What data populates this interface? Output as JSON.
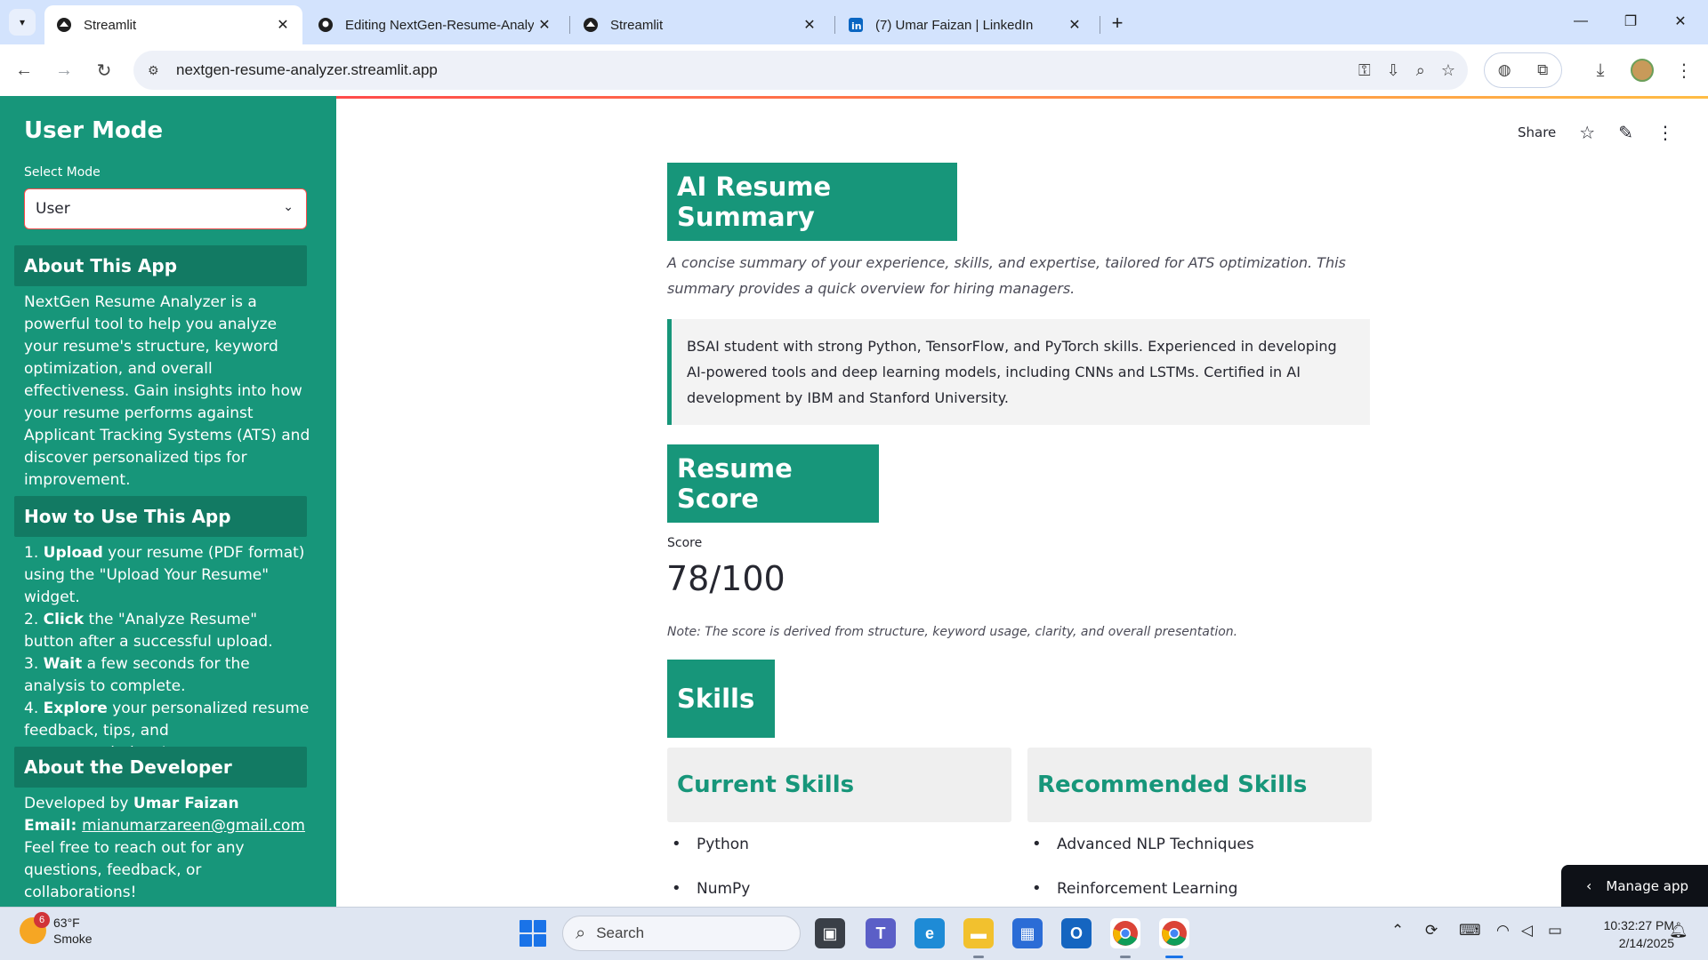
{
  "browser": {
    "tabs": [
      {
        "title": "Streamlit",
        "icon": "streamlit-icon",
        "active": true
      },
      {
        "title": "Editing NextGen-Resume-Analy",
        "icon": "github-icon",
        "active": false
      },
      {
        "title": "Streamlit",
        "icon": "streamlit-icon",
        "active": false
      },
      {
        "title": "(7) Umar Faizan | LinkedIn",
        "icon": "linkedin-icon",
        "active": false
      }
    ],
    "url": "nextgen-resume-analyzer.streamlit.app"
  },
  "sidebar": {
    "title": "User Mode",
    "select_label": "Select Mode",
    "select_value": "User",
    "about": {
      "heading": "About This App",
      "text": "NextGen Resume Analyzer is a powerful tool to help you analyze your resume's structure, keyword optimization, and overall effectiveness. Gain insights into how your resume performs against Applicant Tracking Systems (ATS) and discover personalized tips for improvement."
    },
    "howto": {
      "heading": "How to Use This App",
      "steps": [
        {
          "num": "1.",
          "bold": "Upload",
          "rest": " your resume (PDF format) using the \"Upload Your Resume\" widget."
        },
        {
          "num": "2.",
          "bold": "Click",
          "rest": " the \"Analyze Resume\" button after a successful upload."
        },
        {
          "num": "3.",
          "bold": "Wait",
          "rest": " a few seconds for the analysis to complete."
        },
        {
          "num": "4.",
          "bold": "Explore",
          "rest": " your personalized resume feedback, tips, and recommendations!"
        }
      ]
    },
    "developer": {
      "heading": "About the Developer",
      "developed_by": "Developed by ",
      "name": "Umar Faizan",
      "email_label": "Email: ",
      "email": "mianumarzareen@gmail.com",
      "text": "Feel free to reach out for any questions, feedback, or collaborations!"
    }
  },
  "main": {
    "share_label": "Share",
    "summary": {
      "heading": "AI Resume Summary",
      "caption": "A concise summary of your experience, skills, and expertise, tailored for ATS optimization. This summary provides a quick overview for hiring managers.",
      "text": "BSAI student with strong Python, TensorFlow, and PyTorch skills. Experienced in developing AI-powered tools and deep learning models, including CNNs and LSTMs. Certified in AI development by IBM and Stanford University."
    },
    "score": {
      "heading": "Resume Score",
      "label": "Score",
      "value": "78/100",
      "note": "Note: The score is derived from structure, keyword usage, clarity, and overall presentation."
    },
    "skills": {
      "heading": "Skills",
      "current_heading": "Current Skills",
      "current": [
        "Python",
        "NumPy"
      ],
      "recommended_heading": "Recommended Skills",
      "recommended": [
        "Advanced NLP Techniques",
        "Reinforcement Learning"
      ]
    },
    "manage_app": "Manage app"
  },
  "taskbar": {
    "weather_temp": "63°F",
    "weather_desc": "Smoke",
    "weather_badge": "6",
    "search_placeholder": "Search",
    "time": "10:32:27 PM",
    "date": "2/14/2025"
  },
  "colors": {
    "accent": "#17967a",
    "accent_dark": "#127a63"
  }
}
